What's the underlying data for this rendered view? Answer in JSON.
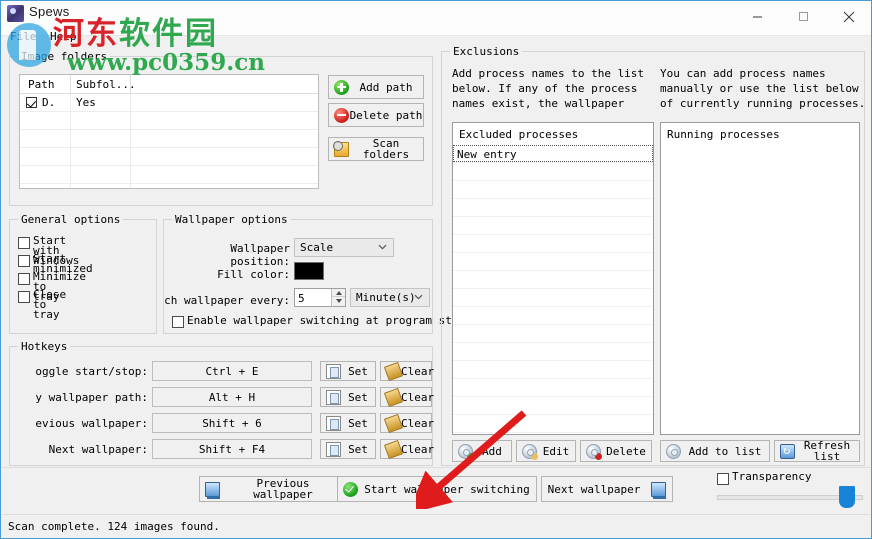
{
  "window": {
    "title": "Spews",
    "icon": "app-icon",
    "controls": {
      "minimize": "minimize-icon",
      "maximize": "maximize-icon",
      "close": "close-icon"
    }
  },
  "menubar": {
    "items": [
      {
        "label": "File"
      },
      {
        "label": "Help"
      }
    ]
  },
  "image_folders": {
    "legend": "Image folders",
    "table": {
      "columns": [
        "Path",
        "Subfol..."
      ],
      "rows": [
        {
          "checked": true,
          "path": "D.",
          "subfolders": "Yes"
        }
      ]
    },
    "buttons": [
      {
        "label": "Add path",
        "icon": "plus-circle-icon"
      },
      {
        "label": "Delete path",
        "icon": "minus-circle-icon"
      },
      {
        "label": "Scan folders",
        "icon": "folder-search-icon"
      }
    ]
  },
  "general_options": {
    "legend": "General options",
    "checkboxes": [
      {
        "label": "Start with\nWindows",
        "checked": false
      },
      {
        "label": "Start\nminimized",
        "checked": false
      },
      {
        "label": "Minimize to\ntray",
        "checked": false
      },
      {
        "label": "Close to tray",
        "checked": false
      }
    ]
  },
  "wallpaper_options": {
    "legend": "Wallpaper options",
    "position_label": "Wallpaper position:",
    "position_value": "Scale",
    "fill_color_label": "Fill color:",
    "fill_color_value": "#000000",
    "interval_label": "ch wallpaper every:",
    "interval_value": "5",
    "interval_unit": "Minute(s)",
    "enable_startup_label": "Enable wallpaper switching at program startup",
    "enable_startup_checked": false
  },
  "hotkeys": {
    "legend": "Hotkeys",
    "set_label": "Set",
    "clear_label": "Clear",
    "rows": [
      {
        "label": "oggle start/stop:",
        "value": "Ctrl + E"
      },
      {
        "label": "y wallpaper path:",
        "value": "Alt + H"
      },
      {
        "label": "evious wallpaper:",
        "value": "Shift + 6"
      },
      {
        "label": "Next wallpaper:",
        "value": "Shift + F4"
      }
    ]
  },
  "exclusions": {
    "legend": "Exclusions",
    "description_left": "Add process names to the list\nbelow.  If any of the process\nnames exist, the wallpaper will",
    "description_right": "You can add process names\nmanually or use the list below\nof currently running processes.",
    "excluded_list": {
      "header": "Excluded processes",
      "items": [
        "New entry"
      ]
    },
    "running_list": {
      "header": "Running processes",
      "items": []
    },
    "buttons": [
      {
        "label": "Add",
        "icon": "gear-plus-icon"
      },
      {
        "label": "Edit",
        "icon": "gear-pencil-icon"
      },
      {
        "label": "Delete",
        "icon": "gear-minus-icon"
      },
      {
        "label": "Add to list",
        "icon": "gear-icon"
      },
      {
        "label": "Refresh\nlist",
        "icon": "refresh-icon"
      }
    ]
  },
  "bottom_bar": {
    "previous_label": "Previous\nwallpaper",
    "start_label": "Start wallpaper switching",
    "next_label": "Next wallpaper",
    "transparency_label": "Transparency",
    "transparency_checked": false,
    "transparency_value": 100
  },
  "statusbar": {
    "text": "Scan complete.  124 images found."
  },
  "watermark": {
    "text_red": "河东",
    "text_green": "软件园",
    "url": "www.pc0359.cn"
  },
  "colors": {
    "accent": "#1884d8",
    "window_border": "#4a9ad4",
    "dialog_bg": "#f0f0f0",
    "annotation_arrow": "#e01b1b"
  }
}
